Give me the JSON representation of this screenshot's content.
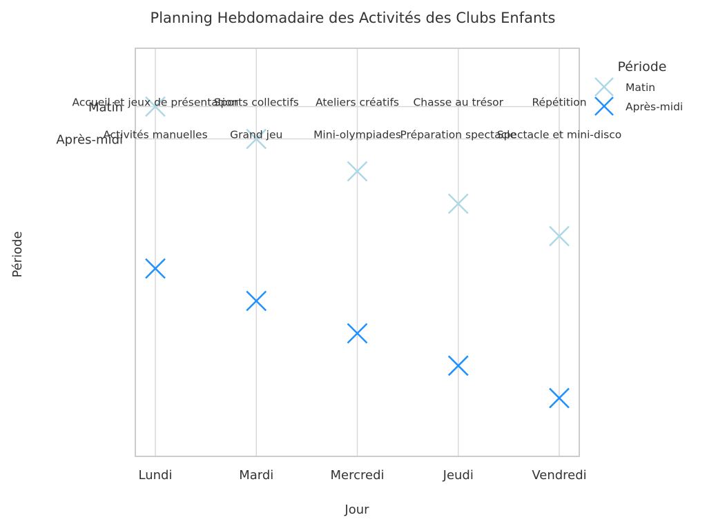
{
  "chart_data": {
    "type": "scatter",
    "title": "Planning Hebdomadaire des Activités des Clubs Enfants",
    "xlabel": "Jour",
    "ylabel": "Période",
    "x_categories": [
      "Lundi",
      "Mardi",
      "Mercredi",
      "Jeudi",
      "Vendredi"
    ],
    "y_tick_labels": [
      "Matin",
      "Après-midi"
    ],
    "y_inverted": true,
    "ylim": [
      -1.8,
      10.8
    ],
    "grid": true,
    "legend": {
      "title": "Période",
      "placement": "outside-right-top"
    },
    "series": [
      {
        "name": "Matin",
        "color": "#ADD8E6",
        "marker": "x",
        "points": [
          {
            "x": "Lundi",
            "y": 0,
            "label": "Accueil et jeux de présentation"
          },
          {
            "x": "Mardi",
            "y": 1,
            "label": "Sports collectifs"
          },
          {
            "x": "Mercredi",
            "y": 2,
            "label": "Ateliers créatifs"
          },
          {
            "x": "Jeudi",
            "y": 3,
            "label": "Chasse au trésor"
          },
          {
            "x": "Vendredi",
            "y": 4,
            "label": "Répétition"
          }
        ]
      },
      {
        "name": "Après-midi",
        "color": "#1E90FF",
        "marker": "x",
        "points": [
          {
            "x": "Lundi",
            "y": 5,
            "label": "Activités manuelles"
          },
          {
            "x": "Mardi",
            "y": 6,
            "label": "Grand jeu"
          },
          {
            "x": "Mercredi",
            "y": 7,
            "label": "Mini-olympiades"
          },
          {
            "x": "Jeudi",
            "y": 8,
            "label": "Préparation spectacle"
          },
          {
            "x": "Vendredi",
            "y": 9,
            "label": "Spectacle et mini-disco"
          }
        ]
      }
    ],
    "annotations": [
      {
        "x": "Lundi",
        "row": "Matin",
        "text": "Accueil et jeux de présentation"
      },
      {
        "x": "Mardi",
        "row": "Matin",
        "text": "Sports collectifs"
      },
      {
        "x": "Mercredi",
        "row": "Matin",
        "text": "Ateliers créatifs"
      },
      {
        "x": "Jeudi",
        "row": "Matin",
        "text": "Chasse au trésor"
      },
      {
        "x": "Vendredi",
        "row": "Matin",
        "text": "Répétition"
      },
      {
        "x": "Lundi",
        "row": "Après-midi",
        "text": "Activités manuelles"
      },
      {
        "x": "Mardi",
        "row": "Après-midi",
        "text": "Grand jeu"
      },
      {
        "x": "Mercredi",
        "row": "Après-midi",
        "text": "Mini-olympiades"
      },
      {
        "x": "Jeudi",
        "row": "Après-midi",
        "text": "Préparation spectacle"
      },
      {
        "x": "Vendredi",
        "row": "Après-midi",
        "text": "Spectacle et mini-disco"
      }
    ]
  }
}
